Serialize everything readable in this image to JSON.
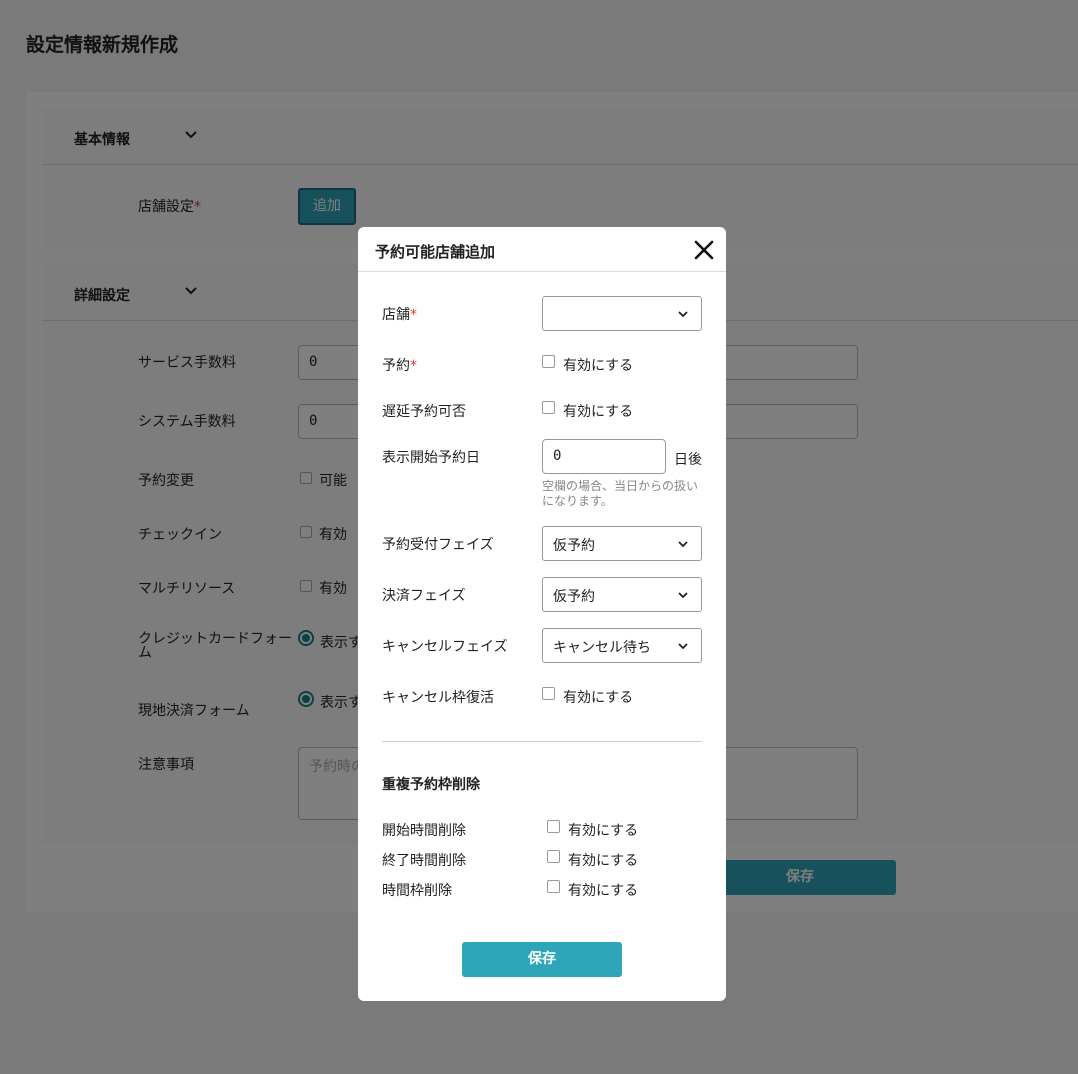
{
  "page": {
    "title": "設定情報新規作成",
    "sections": {
      "basic": {
        "title": "基本情報",
        "store_setting_label": "店舗設定",
        "required_mark": "*",
        "add_label": "追加"
      },
      "detail": {
        "title": "詳細設定"
      }
    },
    "fields": [
      {
        "label": "サービス手数料",
        "value": "0"
      },
      {
        "label": "システム手数料",
        "value": "0"
      },
      {
        "label": "予約変更",
        "option": "可能"
      },
      {
        "label": "チェックイン",
        "option": "有効"
      },
      {
        "label": "マルチリソース",
        "option": "有効"
      },
      {
        "label": "クレジットカードフォーム",
        "option": "表示す"
      },
      {
        "label": "現地決済フォーム",
        "option": "表示す"
      },
      {
        "label": "注意事項",
        "placeholder": "予約時の"
      }
    ],
    "save_label": "保存"
  },
  "modal": {
    "title": "予約可能店舗追加",
    "required_mark": "*",
    "store": {
      "label": "店舗",
      "value": ""
    },
    "reservation": {
      "label": "予約",
      "checkbox_label": "有効にする",
      "checked": false
    },
    "late_reservation": {
      "label": "遅延予約可否",
      "checkbox_label": "有効にする",
      "checked": false
    },
    "display_start": {
      "label": "表示開始予約日",
      "value": "0",
      "unit": "日後",
      "hint": "空欄の場合、当日からの扱いになります。"
    },
    "accept_phase": {
      "label": "予約受付フェイズ",
      "value": "仮予約"
    },
    "payment_phase": {
      "label": "決済フェイズ",
      "value": "仮予約"
    },
    "cancel_phase": {
      "label": "キャンセルフェイズ",
      "value": "キャンセル待ち"
    },
    "cancel_restore": {
      "label": "キャンセル枠復活",
      "checkbox_label": "有効にする",
      "checked": false
    },
    "duplicate": {
      "title": "重複予約枠削除",
      "items": [
        {
          "label": "開始時間削除",
          "checkbox_label": "有効にする",
          "checked": false
        },
        {
          "label": "終了時間削除",
          "checkbox_label": "有効にする",
          "checked": false
        },
        {
          "label": "時間枠削除",
          "checkbox_label": "有効にする",
          "checked": false
        }
      ]
    },
    "save_label": "保存"
  },
  "colors": {
    "accent": "#2ea5b8",
    "required": "#e03a3a",
    "radio": "#1a7f8a"
  }
}
